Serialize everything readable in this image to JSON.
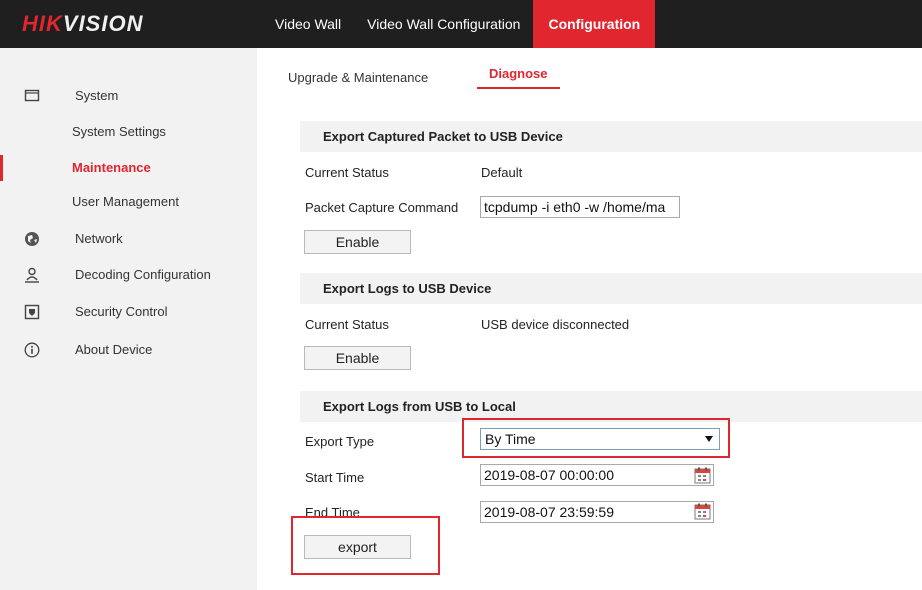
{
  "brand": {
    "logo_prefix": "HIK",
    "logo_suffix": "VISION"
  },
  "top_nav": [
    {
      "label": "Video Wall",
      "active": false
    },
    {
      "label": "Video Wall Configuration",
      "active": false
    },
    {
      "label": "Configuration",
      "active": true
    }
  ],
  "sidebar": {
    "items": [
      {
        "label": "System",
        "icon": "monitor-icon",
        "kind": "group"
      },
      {
        "label": "System Settings",
        "kind": "sub"
      },
      {
        "label": "Maintenance",
        "kind": "sub",
        "active": true
      },
      {
        "label": "User Management",
        "kind": "sub"
      },
      {
        "label": "Network",
        "icon": "globe-icon",
        "kind": "group"
      },
      {
        "label": "Decoding Configuration",
        "icon": "person-icon",
        "kind": "group"
      },
      {
        "label": "Security Control",
        "icon": "shield-icon",
        "kind": "group"
      },
      {
        "label": "About Device",
        "icon": "info-icon",
        "kind": "group"
      }
    ]
  },
  "tabs": [
    {
      "label": "Upgrade & Maintenance",
      "active": false
    },
    {
      "label": "Diagnose",
      "active": true
    }
  ],
  "packet_section": {
    "title": "Export Captured Packet to USB Device",
    "status_label": "Current Status",
    "status_value": "Default",
    "command_label": "Packet Capture Command",
    "command_value": "tcpdump -i eth0 -w /home/ma",
    "enable_label": "Enable"
  },
  "logs_section": {
    "title": "Export Logs to USB Device",
    "status_label": "Current Status",
    "status_value": "USB device disconnected",
    "enable_label": "Enable"
  },
  "usb_local_section": {
    "title": "Export Logs from USB to Local",
    "export_type_label": "Export Type",
    "export_type_value": "By Time",
    "start_label": "Start Time",
    "start_value": "2019-08-07 00:00:00",
    "end_label": "End Time",
    "end_value": "2019-08-07 23:59:59",
    "export_label": "export"
  },
  "colors": {
    "accent": "#e0262f",
    "topbar": "#1f1f1f",
    "sidebar": "#f2f2f2"
  }
}
